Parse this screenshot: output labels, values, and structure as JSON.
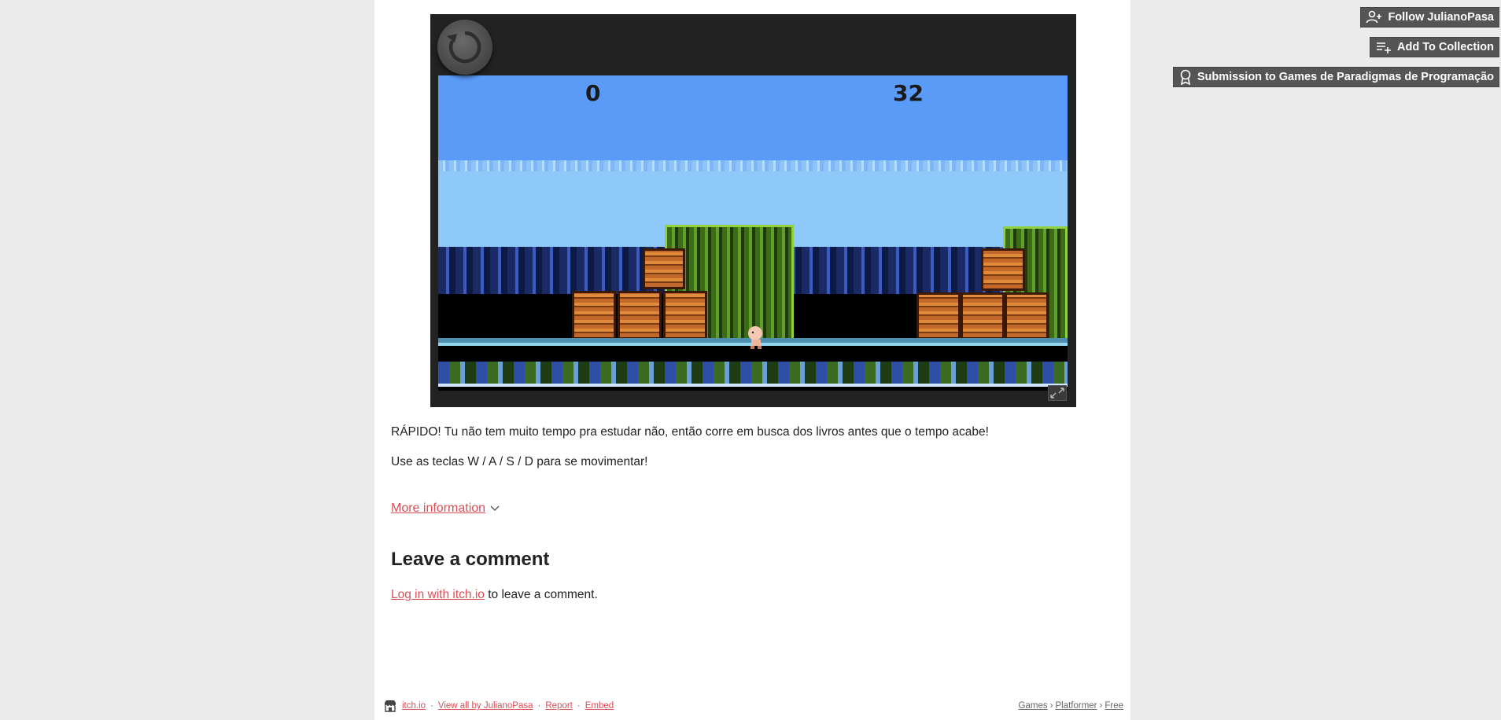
{
  "side_actions": {
    "follow_label": "Follow JulianoPasa",
    "collection_label": "Add To Collection",
    "submission_label": "Submission to Games de Paradigmas de Programação"
  },
  "game": {
    "score_left": "0",
    "score_right": "32"
  },
  "description": {
    "line1": "RÁPIDO! Tu não tem muito tempo pra estudar não, então corre em busca dos livros antes que o tempo acabe!",
    "line2": "Use as teclas W / A / S / D para se movimentar!"
  },
  "more_info_label": "More information",
  "comments": {
    "heading": "Leave a comment",
    "login_link": "Log in with itch.io",
    "login_suffix": " to leave a comment."
  },
  "footer": {
    "itch_link": "itch.io",
    "view_all": "View all by JulianoPasa",
    "report": "Report",
    "embed": "Embed",
    "dot": "·",
    "breadcrumbs": [
      "Games",
      "Platformer",
      "Free"
    ],
    "crumb_sep": "›"
  },
  "icons": {
    "reload": "reload-icon",
    "fullscreen": "fullscreen-icon",
    "follow": "user-plus-icon",
    "collection": "playlist-add-icon",
    "submission": "award-icon",
    "itch_logo": "itchio-logo-icon",
    "chevron": "chevron-down-icon"
  }
}
